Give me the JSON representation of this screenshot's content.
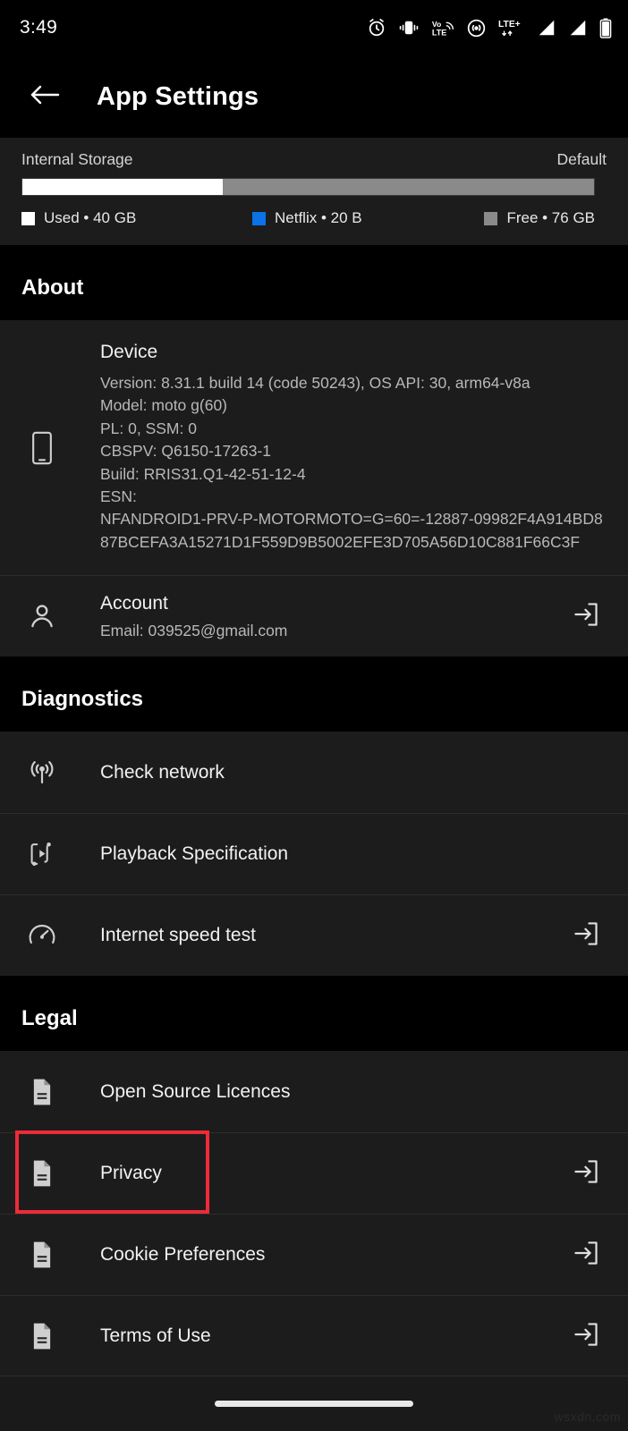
{
  "status_bar": {
    "time": "3:49",
    "icons": [
      "alarm-icon",
      "vibrate-icon",
      "volte-icon",
      "hotspot-icon",
      "lte-plus-icon",
      "signal-icon-1",
      "signal-icon-2",
      "battery-icon"
    ],
    "network_label": "LTE+",
    "volte_label_top": "Vo",
    "volte_label_bottom": "LTE"
  },
  "app_bar": {
    "back_icon": "arrow-left-icon",
    "title": "App Settings"
  },
  "storage": {
    "label": "Internal Storage",
    "type": "Default",
    "bar": {
      "used_pct": 35,
      "app_pct": 0,
      "free_pct": 65
    },
    "legend": [
      {
        "name": "Used",
        "value": "40 GB",
        "text": "Used • 40 GB",
        "color": "#ffffff"
      },
      {
        "name": "Netflix",
        "value": "20 B",
        "text": "Netflix • 20 B",
        "color": "#0b72e8"
      },
      {
        "name": "Free",
        "value": "76 GB",
        "text": "Free • 76 GB",
        "color": "#8a8a8a"
      }
    ]
  },
  "sections": {
    "about": {
      "header": "About",
      "device": {
        "icon": "phone-icon",
        "title": "Device",
        "lines": [
          "Version: 8.31.1 build 14 (code 50243), OS API: 30, arm64-v8a",
          "Model: moto g(60)",
          "PL: 0, SSM: 0",
          "CBSPV: Q6150-17263-1",
          "Build: RRIS31.Q1-42-51-12-4",
          "ESN:",
          "NFANDROID1-PRV-P-MOTORMOTO=G=60=-12887-09982F4A914BD887BCEFA3A15271D1F559D9B5002EFE3D705A56D10C881F66C3F"
        ]
      },
      "account": {
        "icon": "person-icon",
        "title": "Account",
        "email_line": "Email: 039525@gmail.com",
        "trailing_icon": "open-external-icon"
      }
    },
    "diagnostics": {
      "header": "Diagnostics",
      "items": [
        {
          "label": "Check network",
          "icon": "broadcast-icon",
          "trailing_icon": ""
        },
        {
          "label": "Playback Specification",
          "icon": "playback-spec-icon",
          "trailing_icon": ""
        },
        {
          "label": "Internet speed test",
          "icon": "speedometer-icon",
          "trailing_icon": "open-external-icon"
        }
      ]
    },
    "legal": {
      "header": "Legal",
      "items": [
        {
          "label": "Open Source Licences",
          "icon": "document-icon",
          "trailing_icon": "",
          "highlighted": false
        },
        {
          "label": "Privacy",
          "icon": "document-icon",
          "trailing_icon": "open-external-icon",
          "highlighted": true
        },
        {
          "label": "Cookie Preferences",
          "icon": "document-icon",
          "trailing_icon": "open-external-icon",
          "highlighted": false
        },
        {
          "label": "Terms of Use",
          "icon": "document-icon",
          "trailing_icon": "open-external-icon",
          "highlighted": false
        }
      ]
    }
  },
  "highlight": {
    "color": "#ee2b37",
    "target": "Privacy"
  },
  "nav_bar": {
    "handle": "home-gesture-pill"
  },
  "watermark": "wsxdn.com"
}
